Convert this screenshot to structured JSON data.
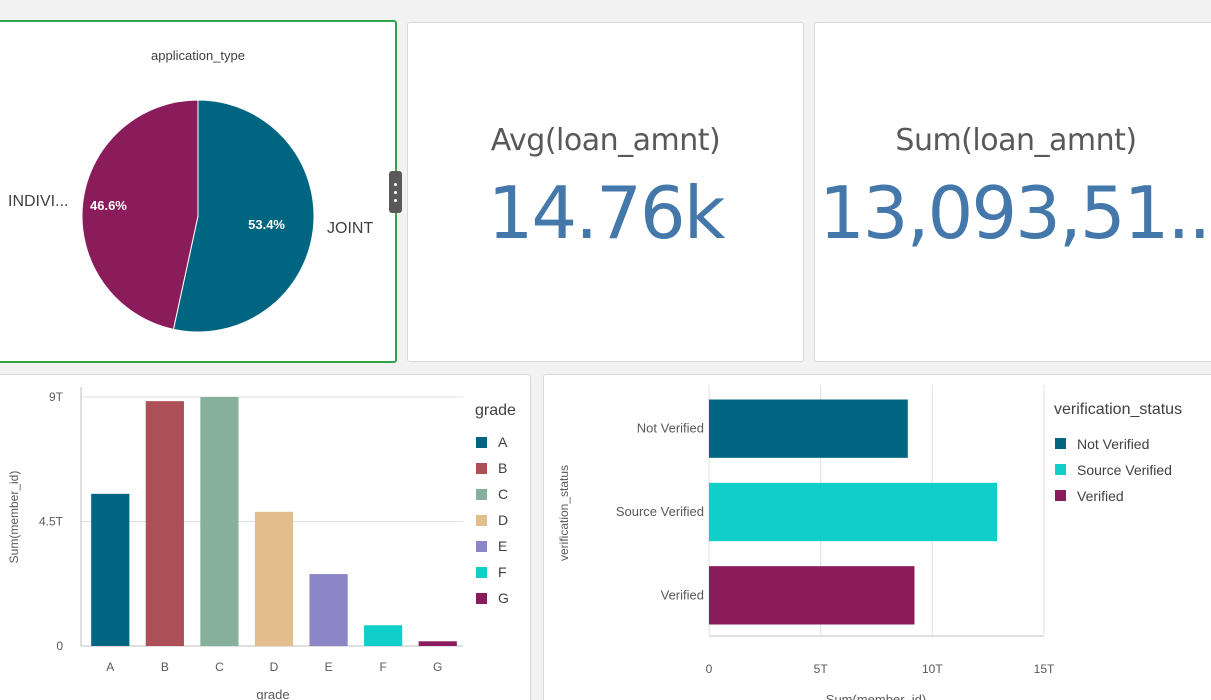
{
  "pie": {
    "title": "application_type",
    "slices": [
      {
        "label": "JOINT",
        "percent_label": "53.4%",
        "value": 53.4,
        "color": "#006580"
      },
      {
        "label": "INDIVI...",
        "percent_label": "46.6%",
        "value": 46.6,
        "color": "#8a1c5b"
      }
    ]
  },
  "kpis": [
    {
      "title": "Avg(loan_amnt)",
      "value": "14.76k"
    },
    {
      "title": "Sum(loan_amnt)",
      "value": "13,093,51..."
    }
  ],
  "chart_data": [
    {
      "type": "bar",
      "xlabel": "grade",
      "ylabel": "Sum(member_id)",
      "categories": [
        "A",
        "B",
        "C",
        "D",
        "E",
        "F",
        "G"
      ],
      "values": [
        5.5,
        8.85,
        9.0,
        4.85,
        2.6,
        0.75,
        0.17
      ],
      "colors": [
        "#006580",
        "#ad4f56",
        "#86b09b",
        "#e1be8b",
        "#8c86c6",
        "#10cfc9",
        "#8a1c5b"
      ],
      "yticks": [
        "0",
        "4.5T",
        "9T"
      ],
      "ytick_values": [
        0,
        4.5,
        9
      ],
      "ylim": [
        0,
        9
      ],
      "legend_title": "grade",
      "legend": [
        "A",
        "B",
        "C",
        "D",
        "E",
        "F",
        "G"
      ],
      "legend_placement": "right",
      "grid": true
    },
    {
      "type": "bar",
      "orientation": "horizontal",
      "xlabel": "Sum(member_id)",
      "ylabel": "verification_status",
      "categories": [
        "Not Verified",
        "Source Verified",
        "Verified"
      ],
      "values": [
        8.9,
        12.9,
        9.2
      ],
      "colors": [
        "#006580",
        "#10cfc9",
        "#8a1c5b"
      ],
      "xticks": [
        "0",
        "5T",
        "10T",
        "15T"
      ],
      "xtick_values": [
        0,
        5,
        10,
        15
      ],
      "xlim": [
        0,
        15
      ],
      "legend_title": "verification_status",
      "legend": [
        "Not Verified",
        "Source Verified",
        "Verified"
      ],
      "legend_placement": "right",
      "grid": true
    }
  ]
}
